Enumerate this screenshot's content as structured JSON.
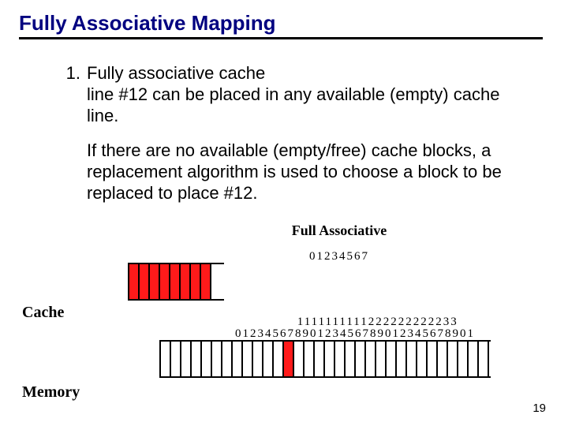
{
  "title": "Fully Associative Mapping",
  "list_number": "1.",
  "item_text": "Fully associative cache",
  "line1": "line #12 can be placed in any available (empty) cache line.",
  "para2": "If there are no available (empty/free) cache blocks, a replacement algorithm is used to choose a block to be replaced to place #12.",
  "full_assoc_label": "Full Associative",
  "cache_label": "Cache",
  "memory_label": "Memory",
  "page_number": "19",
  "cache_idx_row1": "        ",
  "cache_idx_row2": "01234567",
  "mem_idx_row1": "          1111111111222222222233",
  "mem_idx_row2": "01234567890123456789012345678901",
  "chart_data": {
    "type": "table",
    "cache_slots": 8,
    "cache_highlight_all": true,
    "memory_slots": 32,
    "memory_highlight_index": 12
  }
}
